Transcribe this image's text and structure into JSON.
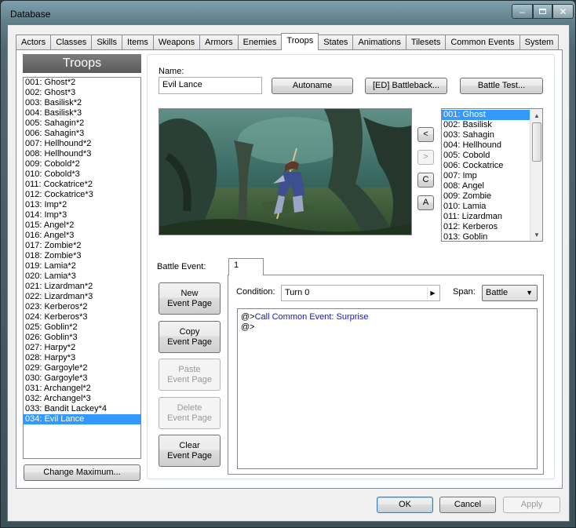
{
  "window": {
    "title": "Database"
  },
  "tabs": [
    "Actors",
    "Classes",
    "Skills",
    "Items",
    "Weapons",
    "Armors",
    "Enemies",
    "Troops",
    "States",
    "Animations",
    "Tilesets",
    "Common Events",
    "System"
  ],
  "active_tab": "Troops",
  "troops": {
    "header": "Troops",
    "items": [
      "001: Ghost*2",
      "002: Ghost*3",
      "003: Basilisk*2",
      "004: Basilisk*3",
      "005: Sahagin*2",
      "006: Sahagin*3",
      "007: Hellhound*2",
      "008: Hellhound*3",
      "009: Cobold*2",
      "010: Cobold*3",
      "011: Cockatrice*2",
      "012: Cockatrice*3",
      "013: Imp*2",
      "014: Imp*3",
      "015: Angel*2",
      "016: Angel*3",
      "017: Zombie*2",
      "018: Zombie*3",
      "019: Lamia*2",
      "020: Lamia*3",
      "021: Lizardman*2",
      "022: Lizardman*3",
      "023: Kerberos*2",
      "024: Kerberos*3",
      "025: Goblin*2",
      "026: Goblin*3",
      "027: Harpy*2",
      "028: Harpy*3",
      "029: Gargoyle*2",
      "030: Gargoyle*3",
      "031: Archangel*2",
      "032: Archangel*3",
      "033: Bandit Lackey*4",
      "034: Evil Lance"
    ],
    "selected": "034: Evil Lance",
    "change_maximum_label": "Change Maximum..."
  },
  "editor": {
    "name_label": "Name:",
    "name_value": "Evil Lance",
    "autoname_label": "Autoname",
    "battleback_label": "[ED] Battleback...",
    "battle_test_label": "Battle Test...",
    "arrow_left": "<",
    "arrow_right": ">",
    "btn_c": "C",
    "btn_a": "A"
  },
  "enemies": {
    "items": [
      "001: Ghost",
      "002: Basilisk",
      "003: Sahagin",
      "004: Hellhound",
      "005: Cobold",
      "006: Cockatrice",
      "007: Imp",
      "008: Angel",
      "009: Zombie",
      "010: Lamia",
      "011: Lizardman",
      "012: Kerberos",
      "013: Goblin"
    ],
    "selected": "001: Ghost"
  },
  "battle_event": {
    "label": "Battle Event:",
    "page_tab": "1",
    "buttons": {
      "new": [
        "New",
        "Event Page"
      ],
      "copy": [
        "Copy",
        "Event Page"
      ],
      "paste": [
        "Paste",
        "Event Page"
      ],
      "delete": [
        "Delete",
        "Event Page"
      ],
      "clear": [
        "Clear",
        "Event Page"
      ]
    },
    "condition_label": "Condition:",
    "condition_value": "Turn 0",
    "span_label": "Span:",
    "span_value": "Battle",
    "lines": [
      {
        "prefix": "@>",
        "text": "Call Common Event: Surprise"
      },
      {
        "prefix": "@>",
        "text": ""
      }
    ]
  },
  "footer": {
    "ok": "OK",
    "cancel": "Cancel",
    "apply": "Apply"
  }
}
